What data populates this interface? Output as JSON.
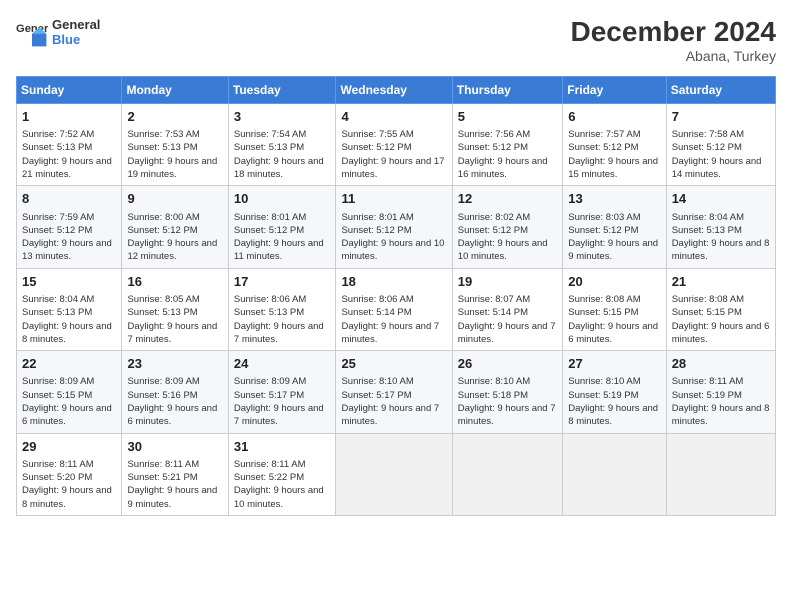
{
  "header": {
    "logo_line1": "General",
    "logo_line2": "Blue",
    "month": "December 2024",
    "location": "Abana, Turkey"
  },
  "columns": [
    "Sunday",
    "Monday",
    "Tuesday",
    "Wednesday",
    "Thursday",
    "Friday",
    "Saturday"
  ],
  "weeks": [
    [
      {
        "day": "1",
        "sunrise": "Sunrise: 7:52 AM",
        "sunset": "Sunset: 5:13 PM",
        "daylight": "Daylight: 9 hours and 21 minutes."
      },
      {
        "day": "2",
        "sunrise": "Sunrise: 7:53 AM",
        "sunset": "Sunset: 5:13 PM",
        "daylight": "Daylight: 9 hours and 19 minutes."
      },
      {
        "day": "3",
        "sunrise": "Sunrise: 7:54 AM",
        "sunset": "Sunset: 5:13 PM",
        "daylight": "Daylight: 9 hours and 18 minutes."
      },
      {
        "day": "4",
        "sunrise": "Sunrise: 7:55 AM",
        "sunset": "Sunset: 5:12 PM",
        "daylight": "Daylight: 9 hours and 17 minutes."
      },
      {
        "day": "5",
        "sunrise": "Sunrise: 7:56 AM",
        "sunset": "Sunset: 5:12 PM",
        "daylight": "Daylight: 9 hours and 16 minutes."
      },
      {
        "day": "6",
        "sunrise": "Sunrise: 7:57 AM",
        "sunset": "Sunset: 5:12 PM",
        "daylight": "Daylight: 9 hours and 15 minutes."
      },
      {
        "day": "7",
        "sunrise": "Sunrise: 7:58 AM",
        "sunset": "Sunset: 5:12 PM",
        "daylight": "Daylight: 9 hours and 14 minutes."
      }
    ],
    [
      {
        "day": "8",
        "sunrise": "Sunrise: 7:59 AM",
        "sunset": "Sunset: 5:12 PM",
        "daylight": "Daylight: 9 hours and 13 minutes."
      },
      {
        "day": "9",
        "sunrise": "Sunrise: 8:00 AM",
        "sunset": "Sunset: 5:12 PM",
        "daylight": "Daylight: 9 hours and 12 minutes."
      },
      {
        "day": "10",
        "sunrise": "Sunrise: 8:01 AM",
        "sunset": "Sunset: 5:12 PM",
        "daylight": "Daylight: 9 hours and 11 minutes."
      },
      {
        "day": "11",
        "sunrise": "Sunrise: 8:01 AM",
        "sunset": "Sunset: 5:12 PM",
        "daylight": "Daylight: 9 hours and 10 minutes."
      },
      {
        "day": "12",
        "sunrise": "Sunrise: 8:02 AM",
        "sunset": "Sunset: 5:12 PM",
        "daylight": "Daylight: 9 hours and 10 minutes."
      },
      {
        "day": "13",
        "sunrise": "Sunrise: 8:03 AM",
        "sunset": "Sunset: 5:12 PM",
        "daylight": "Daylight: 9 hours and 9 minutes."
      },
      {
        "day": "14",
        "sunrise": "Sunrise: 8:04 AM",
        "sunset": "Sunset: 5:13 PM",
        "daylight": "Daylight: 9 hours and 8 minutes."
      }
    ],
    [
      {
        "day": "15",
        "sunrise": "Sunrise: 8:04 AM",
        "sunset": "Sunset: 5:13 PM",
        "daylight": "Daylight: 9 hours and 8 minutes."
      },
      {
        "day": "16",
        "sunrise": "Sunrise: 8:05 AM",
        "sunset": "Sunset: 5:13 PM",
        "daylight": "Daylight: 9 hours and 7 minutes."
      },
      {
        "day": "17",
        "sunrise": "Sunrise: 8:06 AM",
        "sunset": "Sunset: 5:13 PM",
        "daylight": "Daylight: 9 hours and 7 minutes."
      },
      {
        "day": "18",
        "sunrise": "Sunrise: 8:06 AM",
        "sunset": "Sunset: 5:14 PM",
        "daylight": "Daylight: 9 hours and 7 minutes."
      },
      {
        "day": "19",
        "sunrise": "Sunrise: 8:07 AM",
        "sunset": "Sunset: 5:14 PM",
        "daylight": "Daylight: 9 hours and 7 minutes."
      },
      {
        "day": "20",
        "sunrise": "Sunrise: 8:08 AM",
        "sunset": "Sunset: 5:15 PM",
        "daylight": "Daylight: 9 hours and 6 minutes."
      },
      {
        "day": "21",
        "sunrise": "Sunrise: 8:08 AM",
        "sunset": "Sunset: 5:15 PM",
        "daylight": "Daylight: 9 hours and 6 minutes."
      }
    ],
    [
      {
        "day": "22",
        "sunrise": "Sunrise: 8:09 AM",
        "sunset": "Sunset: 5:15 PM",
        "daylight": "Daylight: 9 hours and 6 minutes."
      },
      {
        "day": "23",
        "sunrise": "Sunrise: 8:09 AM",
        "sunset": "Sunset: 5:16 PM",
        "daylight": "Daylight: 9 hours and 6 minutes."
      },
      {
        "day": "24",
        "sunrise": "Sunrise: 8:09 AM",
        "sunset": "Sunset: 5:17 PM",
        "daylight": "Daylight: 9 hours and 7 minutes."
      },
      {
        "day": "25",
        "sunrise": "Sunrise: 8:10 AM",
        "sunset": "Sunset: 5:17 PM",
        "daylight": "Daylight: 9 hours and 7 minutes."
      },
      {
        "day": "26",
        "sunrise": "Sunrise: 8:10 AM",
        "sunset": "Sunset: 5:18 PM",
        "daylight": "Daylight: 9 hours and 7 minutes."
      },
      {
        "day": "27",
        "sunrise": "Sunrise: 8:10 AM",
        "sunset": "Sunset: 5:19 PM",
        "daylight": "Daylight: 9 hours and 8 minutes."
      },
      {
        "day": "28",
        "sunrise": "Sunrise: 8:11 AM",
        "sunset": "Sunset: 5:19 PM",
        "daylight": "Daylight: 9 hours and 8 minutes."
      }
    ],
    [
      {
        "day": "29",
        "sunrise": "Sunrise: 8:11 AM",
        "sunset": "Sunset: 5:20 PM",
        "daylight": "Daylight: 9 hours and 8 minutes."
      },
      {
        "day": "30",
        "sunrise": "Sunrise: 8:11 AM",
        "sunset": "Sunset: 5:21 PM",
        "daylight": "Daylight: 9 hours and 9 minutes."
      },
      {
        "day": "31",
        "sunrise": "Sunrise: 8:11 AM",
        "sunset": "Sunset: 5:22 PM",
        "daylight": "Daylight: 9 hours and 10 minutes."
      },
      null,
      null,
      null,
      null
    ]
  ]
}
